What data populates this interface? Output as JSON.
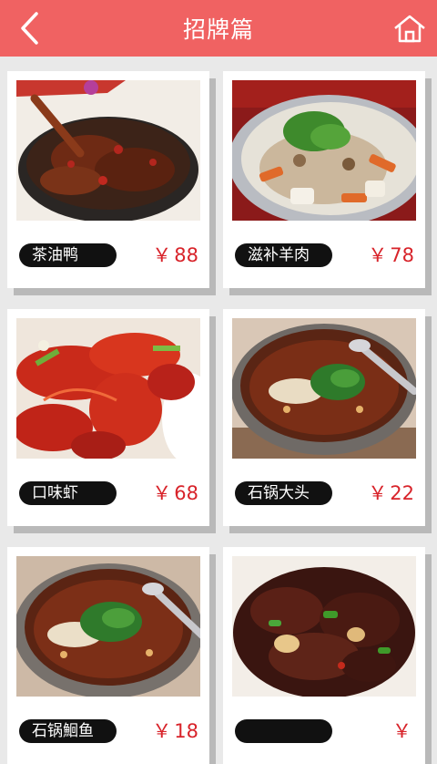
{
  "header": {
    "title": "招牌篇",
    "back_icon": "chevron-left-icon",
    "home_icon": "home-icon",
    "color": "#f06262"
  },
  "currency": "￥",
  "dishes": [
    {
      "name": "茶油鸭",
      "price": "88"
    },
    {
      "name": "滋补羊肉",
      "price": "78"
    },
    {
      "name": "口味虾",
      "price": "68"
    },
    {
      "name": "石锅大头",
      "price": "22"
    },
    {
      "name": "石锅鮰鱼",
      "price": "18"
    },
    {
      "name": "",
      "price": ""
    }
  ]
}
